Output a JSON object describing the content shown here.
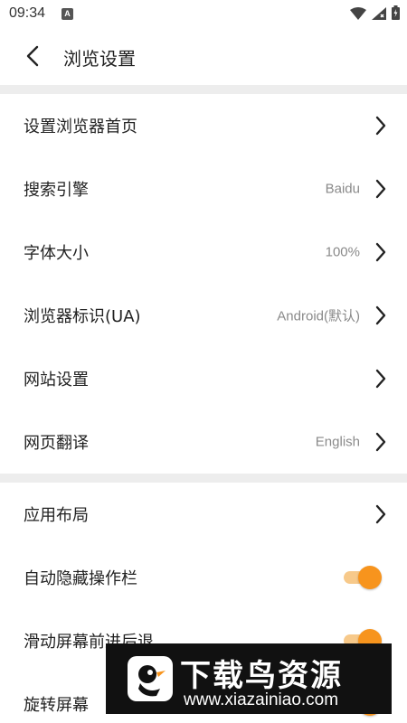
{
  "status_bar": {
    "time": "09:34",
    "notification_badge": "A",
    "icons": [
      "wifi-icon",
      "signal-icon",
      "battery-icon"
    ]
  },
  "header": {
    "title": "浏览设置",
    "back_icon": "back-arrow-icon"
  },
  "settings_group_1": [
    {
      "label": "设置浏览器首页",
      "value": ""
    },
    {
      "label": "搜索引擎",
      "value": "Baidu"
    },
    {
      "label": "字体大小",
      "value": "100%"
    },
    {
      "label": "浏览器标识(UA)",
      "value": "Android(默认)"
    },
    {
      "label": "网站设置",
      "value": ""
    },
    {
      "label": "网页翻译",
      "value": "English"
    }
  ],
  "settings_group_2": [
    {
      "label": "应用布局",
      "type": "link"
    },
    {
      "label": "自动隐藏操作栏",
      "type": "toggle",
      "on": true
    },
    {
      "label": "滑动屏幕前进后退",
      "type": "toggle",
      "on": true
    },
    {
      "label": "旋转屏幕",
      "type": "toggle",
      "on": true
    }
  ],
  "colors": {
    "accent": "#f7941d",
    "accent_light": "#f7c98a",
    "divider": "#ededed",
    "value_text": "#8a8a8a"
  },
  "watermark": {
    "title": "下载鸟资源",
    "url": "www.xiazainiao.com"
  }
}
